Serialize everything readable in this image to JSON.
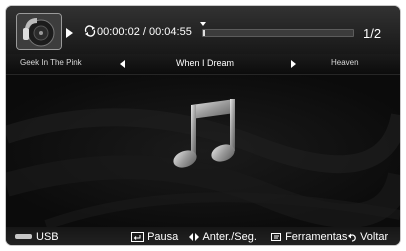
{
  "player": {
    "elapsed": "00:00:02",
    "separator": "/",
    "duration": "00:04:55",
    "counter": "1/2",
    "progress_fraction": 0.01
  },
  "tracks": {
    "previous": "Geek In The Pink",
    "current": "When I Dream",
    "next": "Heaven"
  },
  "source": {
    "label": "USB"
  },
  "hints": {
    "pause_label": "Pausa",
    "prev_next_label": "Anter./Seg.",
    "tools_label": "Ferramentas",
    "back_label": "Voltar"
  },
  "icons": [
    "album-art-icon",
    "play-icon",
    "repeat-icon",
    "music-note-icon",
    "usb-icon",
    "enter-icon",
    "left-right-icon",
    "tools-icon",
    "return-icon"
  ]
}
